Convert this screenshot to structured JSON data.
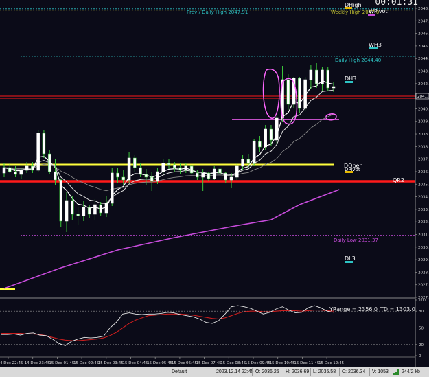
{
  "timer": "00:01:31",
  "levels": {
    "prev_daily_high": "Prev / Daily High 2047.91",
    "weekly_high": "Weekly High 2047.0",
    "wpivot": "WPivot",
    "dhigh": "DHigh",
    "wh3": "WH3",
    "daily_high": "Daily High 2044.40",
    "dh3": "DH3",
    "dopen": "DOpen",
    "dpivot": "DPivot",
    "qr2": "QR2",
    "daily_low": "Daily Low 2031.37",
    "dl3": "DL3"
  },
  "price_axis": [
    "2048.0",
    "2047.1",
    "2046.3",
    "2045.3",
    "2044.4",
    "2043.4",
    "2042.5",
    "2041.7",
    "2040.7",
    "2039.8",
    "2038.9",
    "2038.0",
    "2037.0",
    "2036.1",
    "2035.2",
    "2034.3",
    "2033.3",
    "2032.5",
    "2031.5",
    "2030.6",
    "2029.7",
    "2028.8",
    "2027.9",
    "2027.0"
  ],
  "osc_axis": [
    "100",
    "80",
    "50",
    "20",
    "0"
  ],
  "osc_text": {
    "yrange": "YRange = 2356.0",
    "td": "TD = 1303.0"
  },
  "time_axis": [
    "4 Dec 22:45",
    "14 Dec 23:45",
    "15 Dec 01:45",
    "15 Dec 02:45",
    "15 Dec 03:45",
    "15 Dec 04:45",
    "15 Dec 05:45",
    "15 Dec 06:45",
    "15 Dec 07:45",
    "15 Dec 08:45",
    "15 Dec 09:45",
    "15 Dec 10:45",
    "15 Dec 11:45",
    "15 Dec 12:45"
  ],
  "status": {
    "profile": "Default",
    "datetime": "2023.12.14 22:45",
    "open": "O: 2036.25",
    "high": "H: 2036.69",
    "low": "L: 2035.58",
    "close": "C: 2036.34",
    "volume": "V: 1053",
    "traffic": "244/2 kb"
  },
  "colors": {
    "bg": "#0b0b18",
    "bull": "#ffffff",
    "bear": "#ffffff",
    "wick": "#3cc83c",
    "yellow_line": "#ffff3c",
    "red_line": "#ff1a1a",
    "magenta_ma": "#c84cdc",
    "pink_annotation": "#ff66ff"
  },
  "chart_data": {
    "type": "candlestick",
    "price_range": [
      2027.0,
      2048.2
    ],
    "candles": [
      [
        2035.9,
        2036.6,
        2035.6,
        2036.3
      ],
      [
        2036.3,
        2036.6,
        2035.9,
        2036.0
      ],
      [
        2036.0,
        2036.4,
        2035.6,
        2035.8
      ],
      [
        2035.8,
        2036.3,
        2035.5,
        2036.1
      ],
      [
        2036.1,
        2036.7,
        2035.9,
        2036.4
      ],
      [
        2036.4,
        2036.7,
        2035.9,
        2036.1
      ],
      [
        2036.1,
        2039.0,
        2036.0,
        2038.8
      ],
      [
        2038.8,
        2039.0,
        2037.0,
        2037.3
      ],
      [
        2037.3,
        2037.6,
        2035.8,
        2036.0
      ],
      [
        2036.0,
        2036.9,
        2035.0,
        2035.4
      ],
      [
        2035.4,
        2035.5,
        2032.0,
        2032.4
      ],
      [
        2032.4,
        2034.5,
        2031.6,
        2033.9
      ],
      [
        2033.9,
        2034.2,
        2032.5,
        2032.9
      ],
      [
        2032.9,
        2033.4,
        2032.1,
        2032.8
      ],
      [
        2032.8,
        2033.9,
        2032.4,
        2033.4
      ],
      [
        2033.4,
        2033.6,
        2032.6,
        2032.9
      ],
      [
        2032.9,
        2034.0,
        2032.5,
        2033.6
      ],
      [
        2033.6,
        2033.8,
        2032.8,
        2033.0
      ],
      [
        2033.0,
        2034.2,
        2032.7,
        2033.7
      ],
      [
        2033.7,
        2036.3,
        2033.5,
        2035.9
      ],
      [
        2035.9,
        2036.3,
        2035.2,
        2035.6
      ],
      [
        2035.6,
        2036.1,
        2035.0,
        2035.4
      ],
      [
        2035.4,
        2037.4,
        2035.2,
        2037.0
      ],
      [
        2037.0,
        2037.2,
        2036.0,
        2036.3
      ],
      [
        2036.3,
        2036.6,
        2035.6,
        2035.8
      ],
      [
        2035.8,
        2036.2,
        2035.0,
        2035.6
      ],
      [
        2035.6,
        2036.0,
        2034.6,
        2035.3
      ],
      [
        2035.3,
        2036.3,
        2035.1,
        2036.0
      ],
      [
        2036.0,
        2036.9,
        2035.8,
        2036.6
      ],
      [
        2036.6,
        2036.9,
        2036.2,
        2036.5
      ],
      [
        2036.5,
        2036.7,
        2036.0,
        2036.3
      ],
      [
        2036.3,
        2036.6,
        2035.8,
        2036.1
      ],
      [
        2036.1,
        2036.6,
        2035.9,
        2036.4
      ],
      [
        2036.4,
        2036.5,
        2035.8,
        2035.9
      ],
      [
        2035.9,
        2036.1,
        2035.4,
        2035.6
      ],
      [
        2035.6,
        2036.2,
        2034.6,
        2035.9
      ],
      [
        2035.9,
        2036.0,
        2035.3,
        2035.5
      ],
      [
        2035.5,
        2036.4,
        2035.4,
        2036.2
      ],
      [
        2036.2,
        2036.5,
        2035.7,
        2035.9
      ],
      [
        2035.9,
        2036.0,
        2035.2,
        2035.4
      ],
      [
        2035.4,
        2035.9,
        2034.8,
        2035.6
      ],
      [
        2035.6,
        2036.6,
        2035.4,
        2036.4
      ],
      [
        2036.4,
        2037.2,
        2036.1,
        2036.9
      ],
      [
        2036.9,
        2037.3,
        2036.3,
        2036.6
      ],
      [
        2036.6,
        2038.4,
        2036.4,
        2038.2
      ],
      [
        2038.2,
        2038.6,
        2037.4,
        2037.8
      ],
      [
        2037.8,
        2039.4,
        2037.6,
        2039.1
      ],
      [
        2039.1,
        2039.4,
        2037.9,
        2038.3
      ],
      [
        2038.3,
        2040.1,
        2038.0,
        2039.9
      ],
      [
        2039.9,
        2043.7,
        2039.6,
        2042.7
      ],
      [
        2042.7,
        2043.1,
        2040.5,
        2040.9
      ],
      [
        2040.9,
        2042.9,
        2040.6,
        2042.8
      ],
      [
        2042.8,
        2042.9,
        2040.3,
        2040.6
      ],
      [
        2040.6,
        2042.9,
        2040.4,
        2042.7
      ],
      [
        2042.7,
        2043.8,
        2042.0,
        2043.4
      ],
      [
        2043.4,
        2043.9,
        2042.1,
        2042.4
      ],
      [
        2042.4,
        2043.6,
        2041.9,
        2043.4
      ],
      [
        2043.4,
        2043.6,
        2041.9,
        2042.1
      ],
      [
        2042.1,
        2042.5,
        2041.8,
        2042.2
      ]
    ],
    "ma_fast_smoothing": 5,
    "ma_mid_smoothing": 9,
    "ma_slow_smoothing": 22,
    "ma_long": [
      [
        0,
        2027.5
      ],
      [
        10,
        2029.0
      ],
      [
        20,
        2030.3
      ],
      [
        30,
        2031.2
      ],
      [
        40,
        2032.0
      ],
      [
        47,
        2032.5
      ],
      [
        52,
        2033.6
      ],
      [
        59,
        2034.7
      ]
    ],
    "horizontal_levels": {
      "prev_daily_high": 2047.91,
      "daily_high": 2044.4,
      "upper_red": 2041.5,
      "pink_line": 2039.8,
      "yellow": 2036.5,
      "red_thick": 2035.3,
      "daily_low": 2031.37
    },
    "oscillator": {
      "range": [
        0,
        100
      ],
      "white": [
        38,
        38,
        39,
        37,
        40,
        41,
        37,
        36,
        30,
        22,
        18,
        26,
        30,
        33,
        32,
        33,
        35,
        50,
        60,
        75,
        77,
        75,
        74,
        75,
        75,
        76,
        78,
        77,
        74,
        72,
        70,
        66,
        60,
        58,
        63,
        75,
        88,
        90,
        88,
        85,
        80,
        75,
        78,
        84,
        88,
        82,
        77,
        78,
        86,
        90,
        86,
        80,
        78
      ],
      "red": [
        40,
        40,
        40,
        40,
        39,
        39,
        38,
        36,
        33,
        30,
        28,
        27,
        27,
        28,
        29,
        30,
        32,
        36,
        42,
        50,
        58,
        64,
        68,
        72,
        73,
        74,
        75,
        75,
        75,
        74,
        73,
        71,
        69,
        67,
        66,
        68,
        72,
        76,
        79,
        80,
        80,
        79,
        79,
        80,
        81,
        81,
        81,
        80,
        81,
        82,
        82,
        81,
        80
      ]
    }
  }
}
